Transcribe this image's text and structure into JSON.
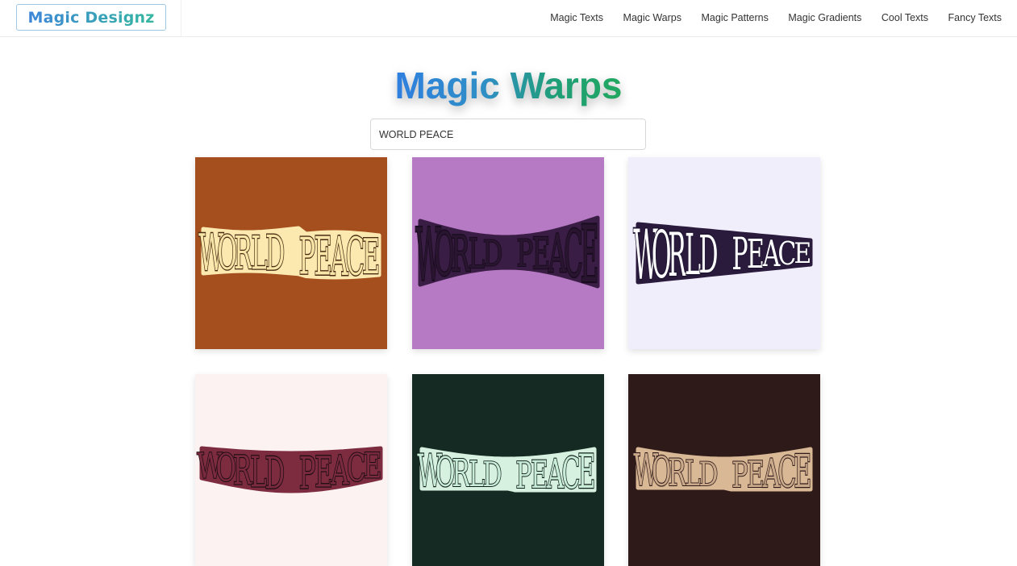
{
  "brand": {
    "name": "Magic Designz"
  },
  "nav": {
    "links": [
      {
        "label": "Magic Texts"
      },
      {
        "label": "Magic Warps"
      },
      {
        "label": "Magic Patterns"
      },
      {
        "label": "Magic Gradients"
      },
      {
        "label": "Cool Texts"
      },
      {
        "label": "Fancy Texts"
      }
    ]
  },
  "page": {
    "title": "Magic Warps"
  },
  "search": {
    "value": "WORLD PEACE"
  },
  "cards": [
    {
      "text": "WORLD PEACE",
      "background": "#a54e1e",
      "fill": "#f7e6a8",
      "outline": "#4a2a10",
      "glow": "#fbe9b0",
      "style": "wave"
    },
    {
      "text": "WORLD PEACE",
      "background": "#b679c4",
      "fill": "#2a1530",
      "outline": "#1a0c20",
      "glow": "#3a1d44",
      "style": "bowtie"
    },
    {
      "text": "WORLD PEACE",
      "background": "#f0eefb",
      "fill": "#ffffff",
      "outline": "#1e1430",
      "glow": "#2a1b3d",
      "style": "trapezoid"
    },
    {
      "text": "WORLD PEACE",
      "background": "#fcf2f2",
      "fill": "#7a2a3e",
      "outline": "#1a0c10",
      "glow": "#7d2c40",
      "style": "arc"
    },
    {
      "text": "WORLD PEACE",
      "background": "#152a22",
      "fill": "#c9ecd8",
      "outline": "#0f1f19",
      "glow": "#d6f1e0",
      "style": "valley"
    },
    {
      "text": "WORLD PEACE",
      "background": "#2e1a18",
      "fill": "#caa98a",
      "outline": "#2e1a18",
      "glow": "#d9b896",
      "style": "valley-flat"
    }
  ]
}
